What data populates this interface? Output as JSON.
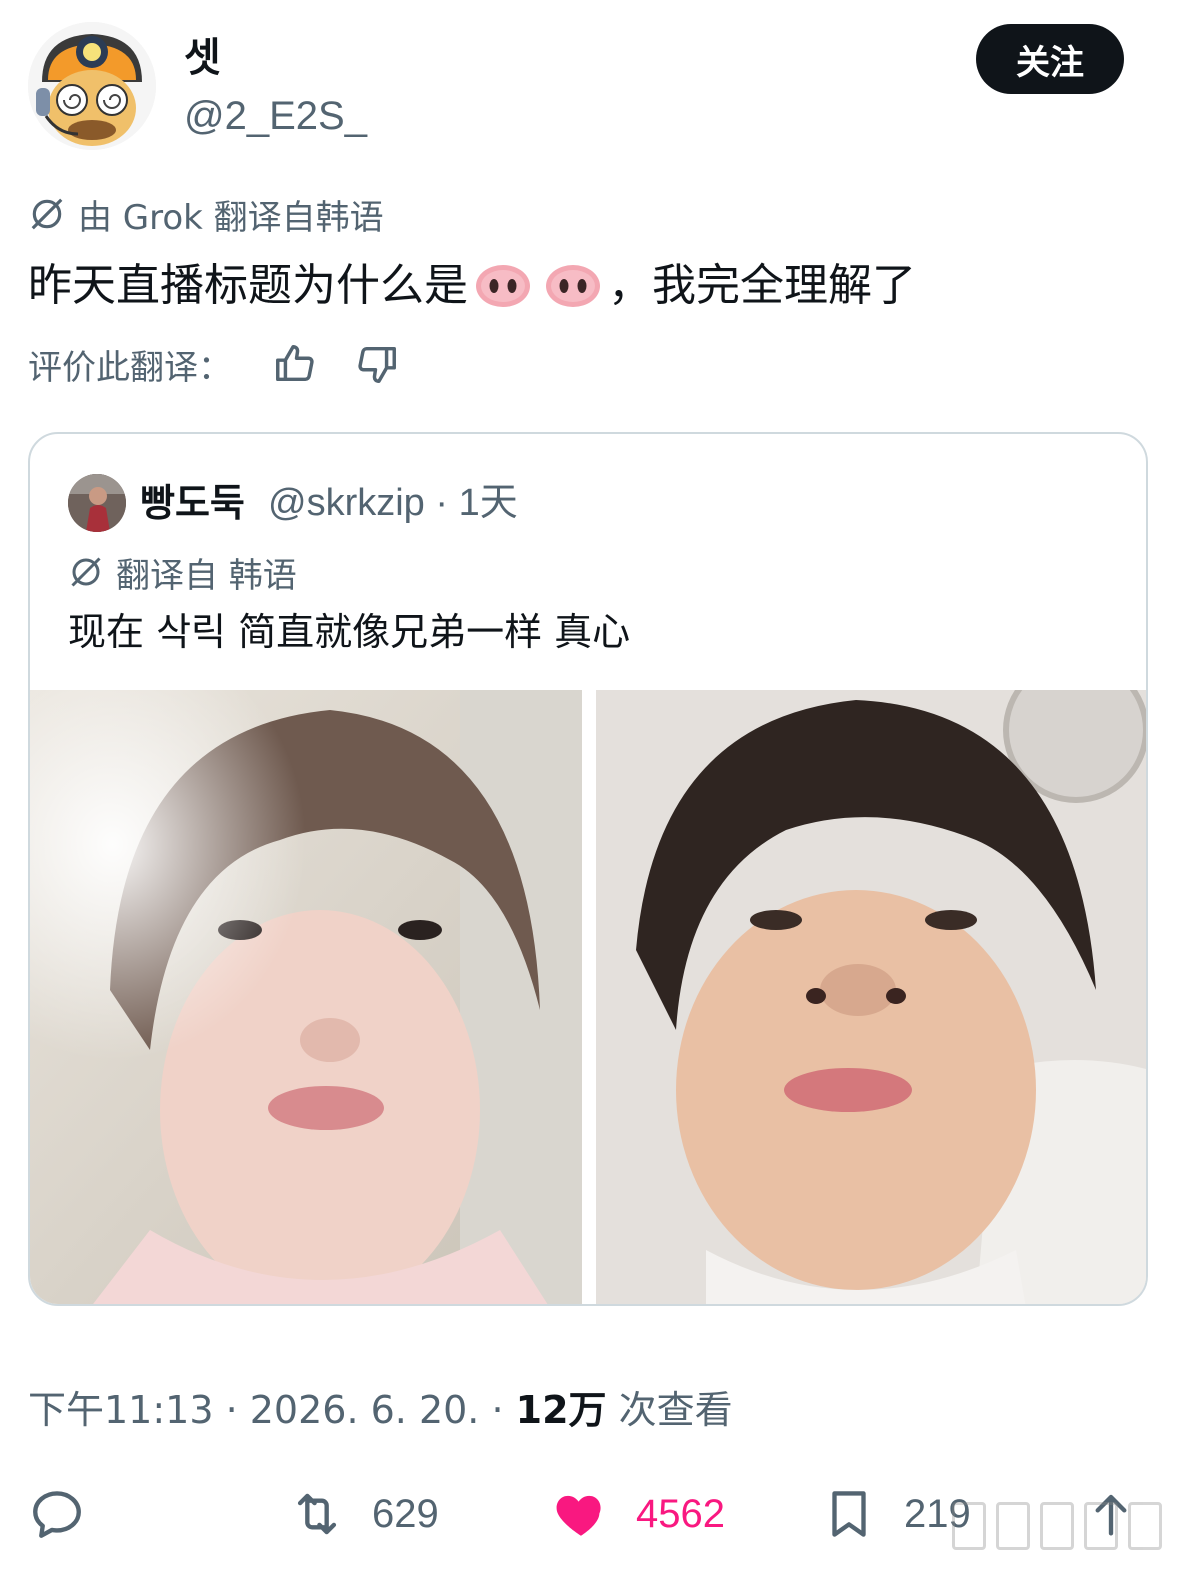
{
  "author": {
    "display_name": "셋",
    "handle": "@2_E2S_",
    "follow_label": "关注"
  },
  "translation": {
    "label": "由 Grok 翻译自韩语"
  },
  "tweet": {
    "text_before": "昨天直播标题为什么是",
    "text_after": "，我完全理解了",
    "emoji_name": "pig-nose"
  },
  "rate": {
    "label": "评价此翻译："
  },
  "quote": {
    "display_name": "빵도둑",
    "handle_time": "@skrkzip · 1天",
    "translation_label": "翻译自 韩语",
    "text": "现在 삭릭 简直就像兄弟一样 真心"
  },
  "meta": {
    "time": "下午11:13 · 2026. 6. 20. · ",
    "views_count": "12万",
    "views_label": " 次查看"
  },
  "actions": {
    "retweets": "629",
    "likes": "4562",
    "bookmarks": "219"
  },
  "colors": {
    "text": "#0f1419",
    "muted": "#536471",
    "like": "#f91880",
    "border": "#cfd9de"
  }
}
